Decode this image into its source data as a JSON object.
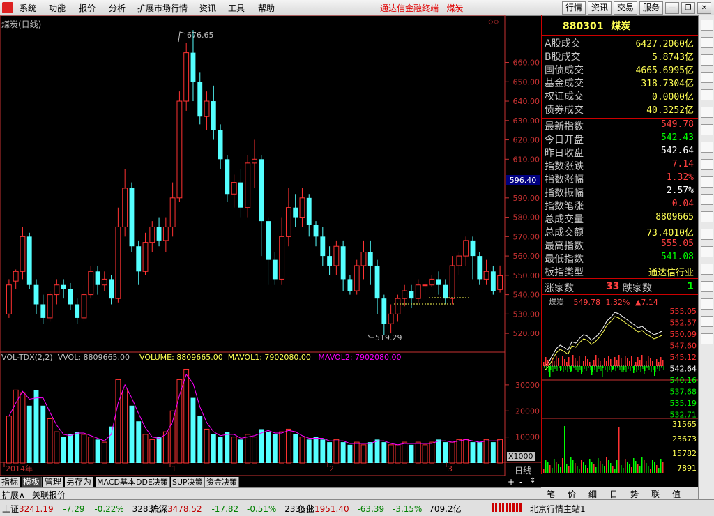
{
  "menu": {
    "items": [
      "系统",
      "功能",
      "报价",
      "分析",
      "扩展市场行情",
      "资讯",
      "工具",
      "帮助"
    ],
    "center_title": "通达信金融终端",
    "center_name": "煤炭",
    "right_buttons": [
      "行情",
      "资讯",
      "交易",
      "服务"
    ]
  },
  "chart": {
    "title": "煤炭(日线)",
    "high_label": "676.65",
    "low_label": "519.29",
    "current_price_tag": "596.40",
    "period_label": "日线",
    "unit_label": "X1000",
    "date_labels": [
      "2014年",
      "1",
      "2",
      "3"
    ],
    "price_axis": [
      "660.00",
      "650.00",
      "640.00",
      "630.00",
      "620.00",
      "610.00",
      "590.00",
      "580.00",
      "570.00",
      "560.00",
      "550.00",
      "540.00",
      "530.00",
      "520.00"
    ],
    "vol_axis": [
      "30000",
      "20000",
      "10000"
    ]
  },
  "volume_header": {
    "name": "VOL-TDX(2,2)",
    "vvol": "VVOL: 8809665.00",
    "volume": "VOLUME: 8809665.00",
    "mavol1": "MAVOL1: 7902080.00",
    "mavol2": "MAVOL2: 7902080.00"
  },
  "chart_data": {
    "type": "candlestick",
    "ylim": [
      515,
      680
    ],
    "candles": [
      [
        530,
        545,
        528,
        548
      ],
      [
        547,
        552,
        543,
        553
      ],
      [
        552,
        570,
        548,
        575
      ],
      [
        570,
        545,
        543,
        572
      ],
      [
        545,
        535,
        530,
        548
      ],
      [
        535,
        528,
        525,
        540
      ],
      [
        528,
        540,
        526,
        542
      ],
      [
        540,
        545,
        535,
        548
      ],
      [
        545,
        543,
        538,
        548
      ],
      [
        543,
        535,
        532,
        546
      ],
      [
        535,
        528,
        525,
        538
      ],
      [
        528,
        540,
        526,
        545
      ],
      [
        540,
        552,
        538,
        555
      ],
      [
        552,
        545,
        540,
        555
      ],
      [
        545,
        548,
        542,
        552
      ],
      [
        548,
        538,
        535,
        550
      ],
      [
        538,
        575,
        536,
        585
      ],
      [
        575,
        595,
        570,
        605
      ],
      [
        595,
        565,
        562,
        598
      ],
      [
        565,
        552,
        545,
        568
      ],
      [
        552,
        567,
        550,
        572
      ],
      [
        567,
        575,
        562,
        578
      ],
      [
        575,
        568,
        565,
        580
      ],
      [
        568,
        575,
        562,
        580
      ],
      [
        575,
        590,
        570,
        598
      ],
      [
        590,
        640,
        588,
        645
      ],
      [
        640,
        665,
        635,
        670
      ],
      [
        665,
        650,
        640,
        676.65
      ],
      [
        650,
        632,
        628,
        655
      ],
      [
        632,
        640,
        625,
        645
      ],
      [
        640,
        625,
        620,
        648
      ],
      [
        625,
        610,
        605,
        628
      ],
      [
        610,
        592,
        588,
        612
      ],
      [
        592,
        598,
        585,
        602
      ],
      [
        598,
        585,
        580,
        605
      ],
      [
        585,
        608,
        580,
        612
      ],
      [
        608,
        610,
        595,
        620
      ],
      [
        610,
        578,
        560,
        612
      ],
      [
        578,
        558,
        545,
        580
      ],
      [
        558,
        548,
        545,
        562
      ],
      [
        548,
        570,
        545,
        580
      ],
      [
        570,
        585,
        565,
        595
      ],
      [
        585,
        580,
        575,
        592
      ],
      [
        580,
        590,
        575,
        595
      ],
      [
        590,
        576,
        570,
        592
      ],
      [
        576,
        570,
        565,
        578
      ],
      [
        570,
        560,
        555,
        575
      ],
      [
        560,
        555,
        550,
        565
      ],
      [
        555,
        565,
        550,
        568
      ],
      [
        565,
        548,
        542,
        568
      ],
      [
        548,
        542,
        540,
        550
      ],
      [
        542,
        555,
        540,
        558
      ],
      [
        555,
        562,
        548,
        568
      ],
      [
        562,
        555,
        545,
        568
      ],
      [
        555,
        538,
        530,
        558
      ],
      [
        538,
        525,
        519.29,
        540
      ],
      [
        525,
        530,
        520,
        535
      ],
      [
        530,
        538,
        526,
        540
      ],
      [
        538,
        542,
        534,
        545
      ],
      [
        542,
        538,
        533,
        545
      ],
      [
        538,
        545,
        536,
        548
      ],
      [
        545,
        545,
        540,
        548
      ],
      [
        545,
        548,
        544,
        550
      ],
      [
        548,
        545,
        540,
        552
      ],
      [
        545,
        538,
        535,
        548
      ],
      [
        538,
        555,
        535,
        560
      ],
      [
        555,
        560,
        550,
        562
      ],
      [
        560,
        568,
        555,
        570
      ],
      [
        568,
        560,
        548,
        570
      ],
      [
        560,
        548,
        545,
        562
      ],
      [
        548,
        552,
        545,
        558
      ],
      [
        552,
        542,
        540,
        555
      ],
      [
        542.64,
        549.78,
        541.08,
        555.05
      ]
    ],
    "volume": [
      18000,
      28000,
      27000,
      22000,
      28000,
      22000,
      17000,
      12000,
      10000,
      11000,
      12000,
      11000,
      10000,
      9000,
      8000,
      14000,
      32000,
      28000,
      22000,
      16000,
      11000,
      9000,
      10000,
      12000,
      20000,
      32000,
      36000,
      25000,
      18000,
      13000,
      11000,
      10000,
      12000,
      10000,
      9000,
      11000,
      10000,
      13000,
      12000,
      11000,
      12000,
      13000,
      11000,
      10000,
      9000,
      10000,
      9000,
      8000,
      9000,
      8000,
      7000,
      8000,
      7000,
      8000,
      9000,
      8000,
      7000,
      7000,
      8000,
      7000,
      8000,
      7000,
      8000,
      9000,
      8000,
      8000,
      9000,
      9000,
      8000,
      8000,
      9000,
      8000,
      9000
    ]
  },
  "quote_panel": {
    "code": "880301",
    "name": "煤炭",
    "rows_a": [
      {
        "label": "A股成交",
        "value": "6427.2060亿",
        "color": "#ffff54"
      },
      {
        "label": "B股成交",
        "value": "5.8743亿",
        "color": "#ffff54"
      },
      {
        "label": "国债成交",
        "value": "4665.6995亿",
        "color": "#ffff54"
      },
      {
        "label": "基金成交",
        "value": "318.7304亿",
        "color": "#ffff54"
      },
      {
        "label": "权证成交",
        "value": "0.0000亿",
        "color": "#ffff54"
      },
      {
        "label": "债券成交",
        "value": "40.3252亿",
        "color": "#ffff54"
      }
    ],
    "rows_b": [
      {
        "label": "最新指数",
        "value": "549.78",
        "color": "#ff4040"
      },
      {
        "label": "今日开盘",
        "value": "542.43",
        "color": "#00ff00"
      },
      {
        "label": "昨日收盘",
        "value": "542.64",
        "color": "#ffffff"
      },
      {
        "label": "指数涨跌",
        "value": "7.14",
        "color": "#ff4040"
      },
      {
        "label": "指数涨幅",
        "value": "1.32%",
        "color": "#ff4040"
      },
      {
        "label": "指数振幅",
        "value": "2.57%",
        "color": "#ffffff"
      },
      {
        "label": "指数笔涨",
        "value": "0.04",
        "color": "#ff4040"
      },
      {
        "label": "总成交量",
        "value": "8809665",
        "color": "#ffff54"
      },
      {
        "label": "总成交额",
        "value": "73.4010亿",
        "color": "#ffff54"
      },
      {
        "label": "最高指数",
        "value": "555.05",
        "color": "#ff4040"
      },
      {
        "label": "最低指数",
        "value": "541.08",
        "color": "#00ff00"
      },
      {
        "label": "板指类型",
        "value": "通达信行业",
        "color": "#ffff54"
      }
    ],
    "up_label": "涨家数",
    "up_value": "33",
    "down_label": "跌家数",
    "down_value": "1"
  },
  "intraday": {
    "name": "煤炭",
    "price": "549.78",
    "pct": "1.32%",
    "change": "▲7.14",
    "price_axis": [
      "555.05",
      "552.57",
      "550.09",
      "547.60",
      "545.12",
      "542.64",
      "540.16",
      "537.68",
      "535.19",
      "532.71"
    ],
    "vol_axis": [
      "31565",
      "23673",
      "15782",
      "7891"
    ]
  },
  "tabs": [
    "指标",
    "模板",
    "管理",
    "另存为",
    "MACD基本",
    "DDE决策",
    "SUP决策",
    "资金决策"
  ],
  "expand_tabs": [
    "扩展∧",
    "关联报价"
  ],
  "right_tabs": [
    "笔",
    "价",
    "细",
    "日",
    "势",
    "联",
    "值"
  ],
  "status": {
    "sh_label": "上证",
    "sh_val": "3241.19",
    "sh_chg": "-7.29",
    "sh_pct": "-0.22%",
    "sh_amt": "3283亿",
    "hs_label": "沪深",
    "hs_val": "3478.52",
    "hs_chg": "-17.82",
    "hs_pct": "-0.51%",
    "hs_amt": "2335亿",
    "cy_label": "创业",
    "cy_val": "1951.40",
    "cy_chg": "-63.39",
    "cy_pct": "-3.15%",
    "cy_amt": "709.2亿",
    "server": "北京行情主站1"
  },
  "colors": {
    "up": "#ff3232",
    "down": "#54ffff",
    "axis": "#c83232",
    "ma": "#ff00ff"
  }
}
